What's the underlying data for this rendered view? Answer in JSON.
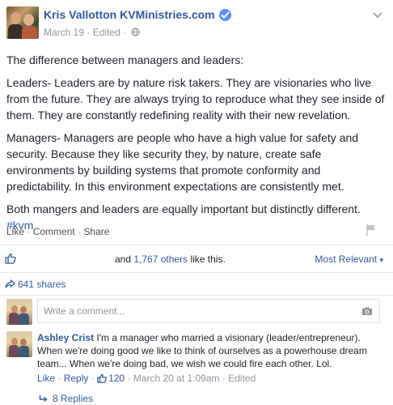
{
  "post": {
    "author": "Kris Vallotton KVMinistries.com",
    "date": "March 19",
    "edited": "Edited",
    "dot": "·",
    "paragraphs": [
      "The difference between managers and leaders:",
      "Leaders- Leaders are by nature risk takers. They are visionaries who live from the future. They are always trying to reproduce what they see inside of them. They are constantly redefining reality with their new revelation.",
      "Managers- Managers are people who have a high value for safety and security. Because they like security they, by nature, create safe environments by building systems that promote conformity and predictability. In this environment expectations are consistently met.",
      "Both mangers and leaders are equally important but distinctly different."
    ],
    "hashtag": "#kvm"
  },
  "actions": {
    "like": "Like",
    "comment": "Comment",
    "share": "Share",
    "dot": "·"
  },
  "likes": {
    "prefix": "and",
    "count": "1,767 others",
    "suffix": "like this.",
    "sort_label": "Most Relevant",
    "sort_arrow": "▾"
  },
  "shares": {
    "label": "641 shares"
  },
  "comment_box": {
    "placeholder": "Write a comment..."
  },
  "comment": {
    "author": "Ashley Crist",
    "text": "I'm a manager who married a visionary (leader/entrepreneur). When we're doing good we like to think of ourselves as a powerhouse dream team... When we're doing bad, we wish we could fire each other. Lol.",
    "like": "Like",
    "reply": "Reply",
    "likes_count": "120",
    "date": "March 20 at 1:09am",
    "edited": "Edited",
    "dot": "·"
  },
  "replies": {
    "label": "8 Replies"
  },
  "colors": {
    "link_blue": "#365899",
    "verified_blue": "#5890ff",
    "muted_gray": "#90949c",
    "text": "#1d2129"
  }
}
